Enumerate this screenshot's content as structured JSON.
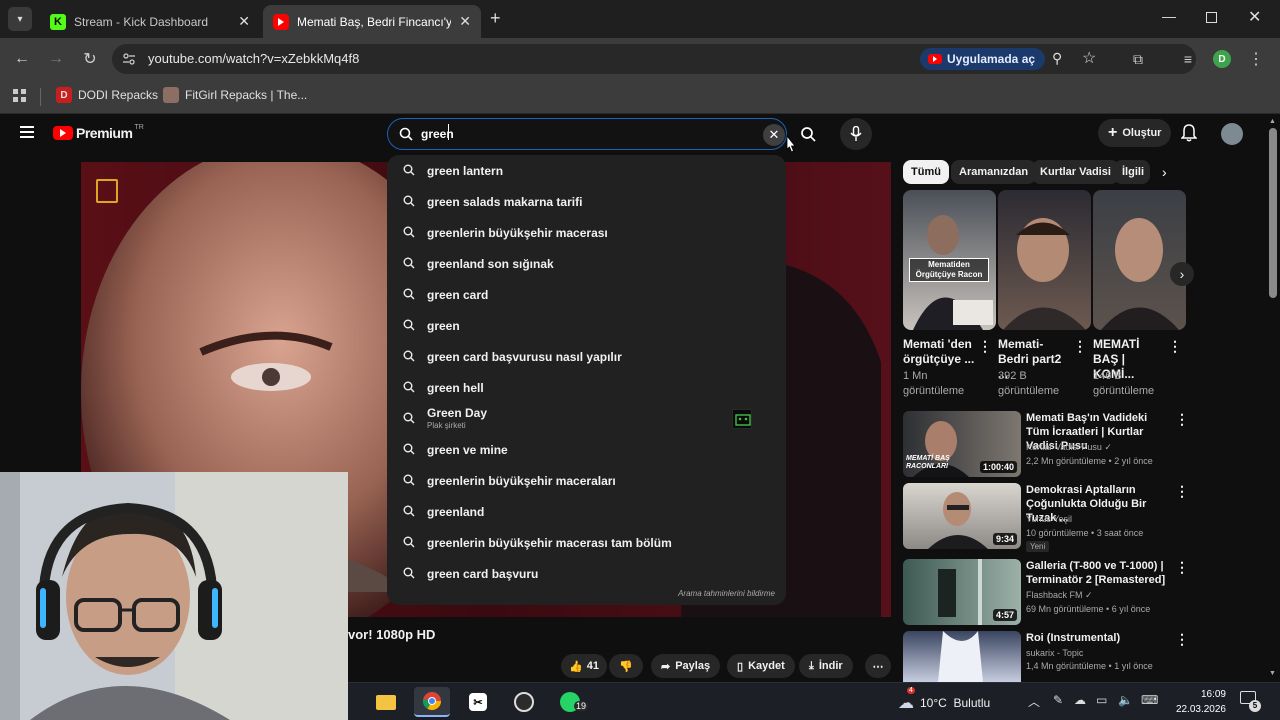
{
  "browser": {
    "tabs": [
      {
        "title": "Stream - Kick Dashboard",
        "active": false
      },
      {
        "title": "Memati Baş, Bedri Fincancı'ya Rest",
        "active": true
      }
    ],
    "url": "youtube.com/watch?v=xZebkkMq4f8",
    "open_in_app": "Uygulamada aç",
    "profile_initial": "D",
    "bookmarks": [
      {
        "label": "DODI Repacks"
      },
      {
        "label": "FitGirl Repacks | The..."
      }
    ]
  },
  "youtube": {
    "logo_text": "Premium",
    "logo_sup": "TR",
    "search_value": "green",
    "create_label": "Oluştur",
    "suggestions": [
      {
        "text": "green lantern"
      },
      {
        "text": "green salads makarna tarifi"
      },
      {
        "text": "greenlerin büyükşehir macerası"
      },
      {
        "text": "greenland son sığınak"
      },
      {
        "text": "green card"
      },
      {
        "text": "green"
      },
      {
        "text": "green card başvurusu nasıl yapılır"
      },
      {
        "text": "green hell"
      },
      {
        "text": "Green Day",
        "subtitle": "Plak şirketi"
      },
      {
        "text": "green ve mine"
      },
      {
        "text": "greenlerin büyükşehir maceraları"
      },
      {
        "text": "greenland"
      },
      {
        "text": "greenlerin büyükşehir macerası tam bölüm"
      },
      {
        "text": "green card başvuru"
      }
    ],
    "suggestions_footer": "Arama tahminlerini bildirme",
    "video_title_partial": "vor! 1080p HD",
    "actions": {
      "likes": "41",
      "share": "Paylaş",
      "save": "Kaydet",
      "download": "İndir"
    },
    "chips": [
      "Tümü",
      "Aramanızdan",
      "Kurtlar Vadisi",
      "İlgili"
    ],
    "shorts": [
      {
        "title": "Memati 'den örgütçüye ...",
        "views": "1 Mn görüntüleme",
        "overlay": "Mematiden Örgütçüye Racon"
      },
      {
        "title": "Memati- Bedri part2 ...",
        "views": "392 B görüntüleme"
      },
      {
        "title": "MEMATİ BAŞ | KOMİ...",
        "views": "146 B görüntüleme"
      }
    ],
    "related": [
      {
        "title": "Memati Baş'ın Vadideki Tüm İcraatleri | Kurtlar Vadisi Pusu",
        "channel": "Kurtlar Vadisi Pusu",
        "meta": "2,2 Mn görüntüleme • 2 yıl önce",
        "duration": "1:00:40",
        "thumb_text": "MEMATİ BAŞ RACONLARI"
      },
      {
        "title": "Demokrasi Aptalların Çoğunlukta Olduğu Bir Tuzak ...",
        "channel": "Yunus Yeşil",
        "meta": "10 görüntüleme • 3 saat önce",
        "badge": "Yeni",
        "duration": "9:34"
      },
      {
        "title": "Galleria (T-800 ve T-1000) | Terminatör 2 [Remastered]",
        "channel": "Flashback FM",
        "meta": "69 Mn görüntüleme • 6 yıl önce",
        "duration": "4:57"
      },
      {
        "title": "Roi (Instrumental)",
        "channel": "sukarix - Topic",
        "meta": "1,4 Mn görüntüleme • 1 yıl önce"
      }
    ]
  },
  "taskbar": {
    "whatsapp_badge": "19",
    "weather_badge": "4",
    "weather": "10°C  Bulutlu",
    "time": "16:09",
    "date": "22.03.2026",
    "notif_count": "5"
  },
  "colors": {
    "accent_red": "#ff0000",
    "search_border": "#1c62b9",
    "bg": "#0f0f0f"
  }
}
